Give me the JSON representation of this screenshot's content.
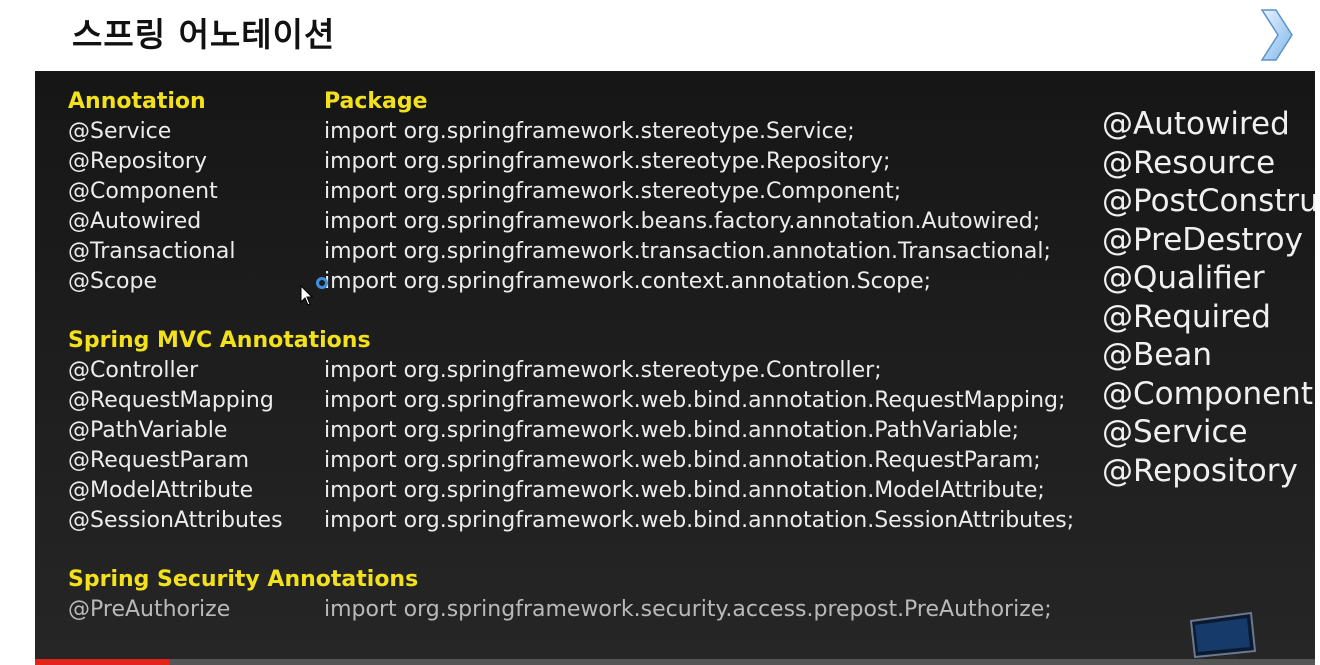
{
  "slide": {
    "title": "스프링 어노테이션"
  },
  "nav": {
    "next_icon": "chevron-right-icon"
  },
  "sections": {
    "core": {
      "header_annotation": "Annotation",
      "header_package": "Package",
      "rows": [
        {
          "annotation": "@Service",
          "package": "import org.springframework.stereotype.Service;"
        },
        {
          "annotation": "@Repository",
          "package": "import org.springframework.stereotype.Repository;"
        },
        {
          "annotation": "@Component",
          "package": "import org.springframework.stereotype.Component;"
        },
        {
          "annotation": "@Autowired",
          "package": "import org.springframework.beans.factory.annotation.Autowired;"
        },
        {
          "annotation": "@Transactional",
          "package": "import org.springframework.transaction.annotation.Transactional;"
        },
        {
          "annotation": "@Scope",
          "package": "import org.springframework.context.annotation.Scope;"
        }
      ]
    },
    "mvc": {
      "header": "Spring MVC Annotations",
      "rows": [
        {
          "annotation": "@Controller",
          "package": "import org.springframework.stereotype.Controller;"
        },
        {
          "annotation": "@RequestMapping",
          "package": "import org.springframework.web.bind.annotation.RequestMapping;"
        },
        {
          "annotation": "@PathVariable",
          "package": "import org.springframework.web.bind.annotation.PathVariable;"
        },
        {
          "annotation": "@RequestParam",
          "package": "import org.springframework.web.bind.annotation.RequestParam;"
        },
        {
          "annotation": "@ModelAttribute",
          "package": "import org.springframework.web.bind.annotation.ModelAttribute;"
        },
        {
          "annotation": "@SessionAttributes",
          "package": "import org.springframework.web.bind.annotation.SessionAttributes;"
        }
      ]
    },
    "security": {
      "header": "Spring Security Annotations",
      "rows": [
        {
          "annotation": "@PreAuthorize",
          "package": "import org.springframework.security.access.prepost.PreAuthorize;"
        }
      ]
    }
  },
  "side_list": [
    "@Autowired",
    "@Resource",
    "@PostConstruct",
    "@PreDestroy",
    "@Qualifier",
    "@Required",
    "@Bean",
    "@Component",
    "@Service",
    "@Repository"
  ],
  "video": {
    "progress": 0.105
  },
  "colors": {
    "heading": "#f3e21b",
    "text": "#ececec",
    "panel_bg": "#1d1d1d",
    "progress": "#e2231a",
    "cursor_ring": "#3d8fe0"
  }
}
